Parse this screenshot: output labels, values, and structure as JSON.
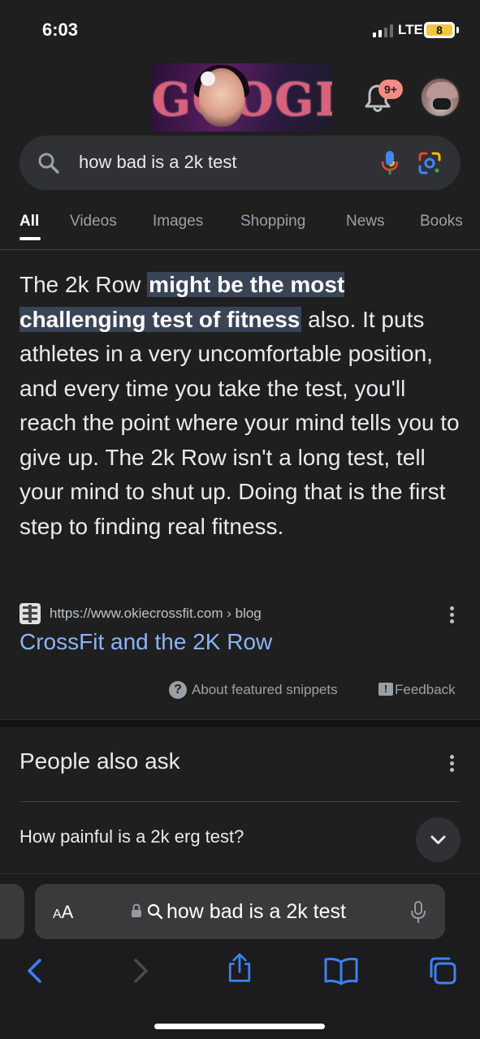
{
  "status_bar": {
    "time": "6:03",
    "network": "LTE",
    "battery": "8"
  },
  "header": {
    "doodle_letters": "GOOGLE",
    "notifications_badge": "9+"
  },
  "search": {
    "query": "how bad is a 2k test"
  },
  "tabs": [
    {
      "label": "All",
      "active": true
    },
    {
      "label": "Videos",
      "active": false
    },
    {
      "label": "Images",
      "active": false
    },
    {
      "label": "Shopping",
      "active": false
    },
    {
      "label": "News",
      "active": false
    },
    {
      "label": "Books",
      "active": false
    }
  ],
  "snippet": {
    "text_before": "The 2k Row ",
    "highlight": "might be the most challenging test of fitness",
    "text_after": " also. It puts athletes in a very uncomfortable position, and every time you take the test, you'll reach the point where your mind tells you to give up. The 2k Row isn't a long test, tell your mind to shut up. Doing that is the first step to finding real fitness.",
    "source_url": "https://www.okiecrossfit.com › blog",
    "title": "CrossFit and the 2K Row",
    "about_label": "About featured snippets",
    "feedback_label": "Feedback"
  },
  "people_also_ask": {
    "title": "People also ask",
    "questions": [
      "How painful is a 2k erg test?"
    ]
  },
  "safari": {
    "aa_label_small": "A",
    "aa_label_large": "A",
    "address_text": "how bad is a 2k test"
  },
  "colors": {
    "background": "#1f1f1f",
    "link": "#8ab4f8",
    "highlight_bg": "#394457",
    "badge": "#f28b82",
    "safari_accent": "#3b82f6"
  }
}
